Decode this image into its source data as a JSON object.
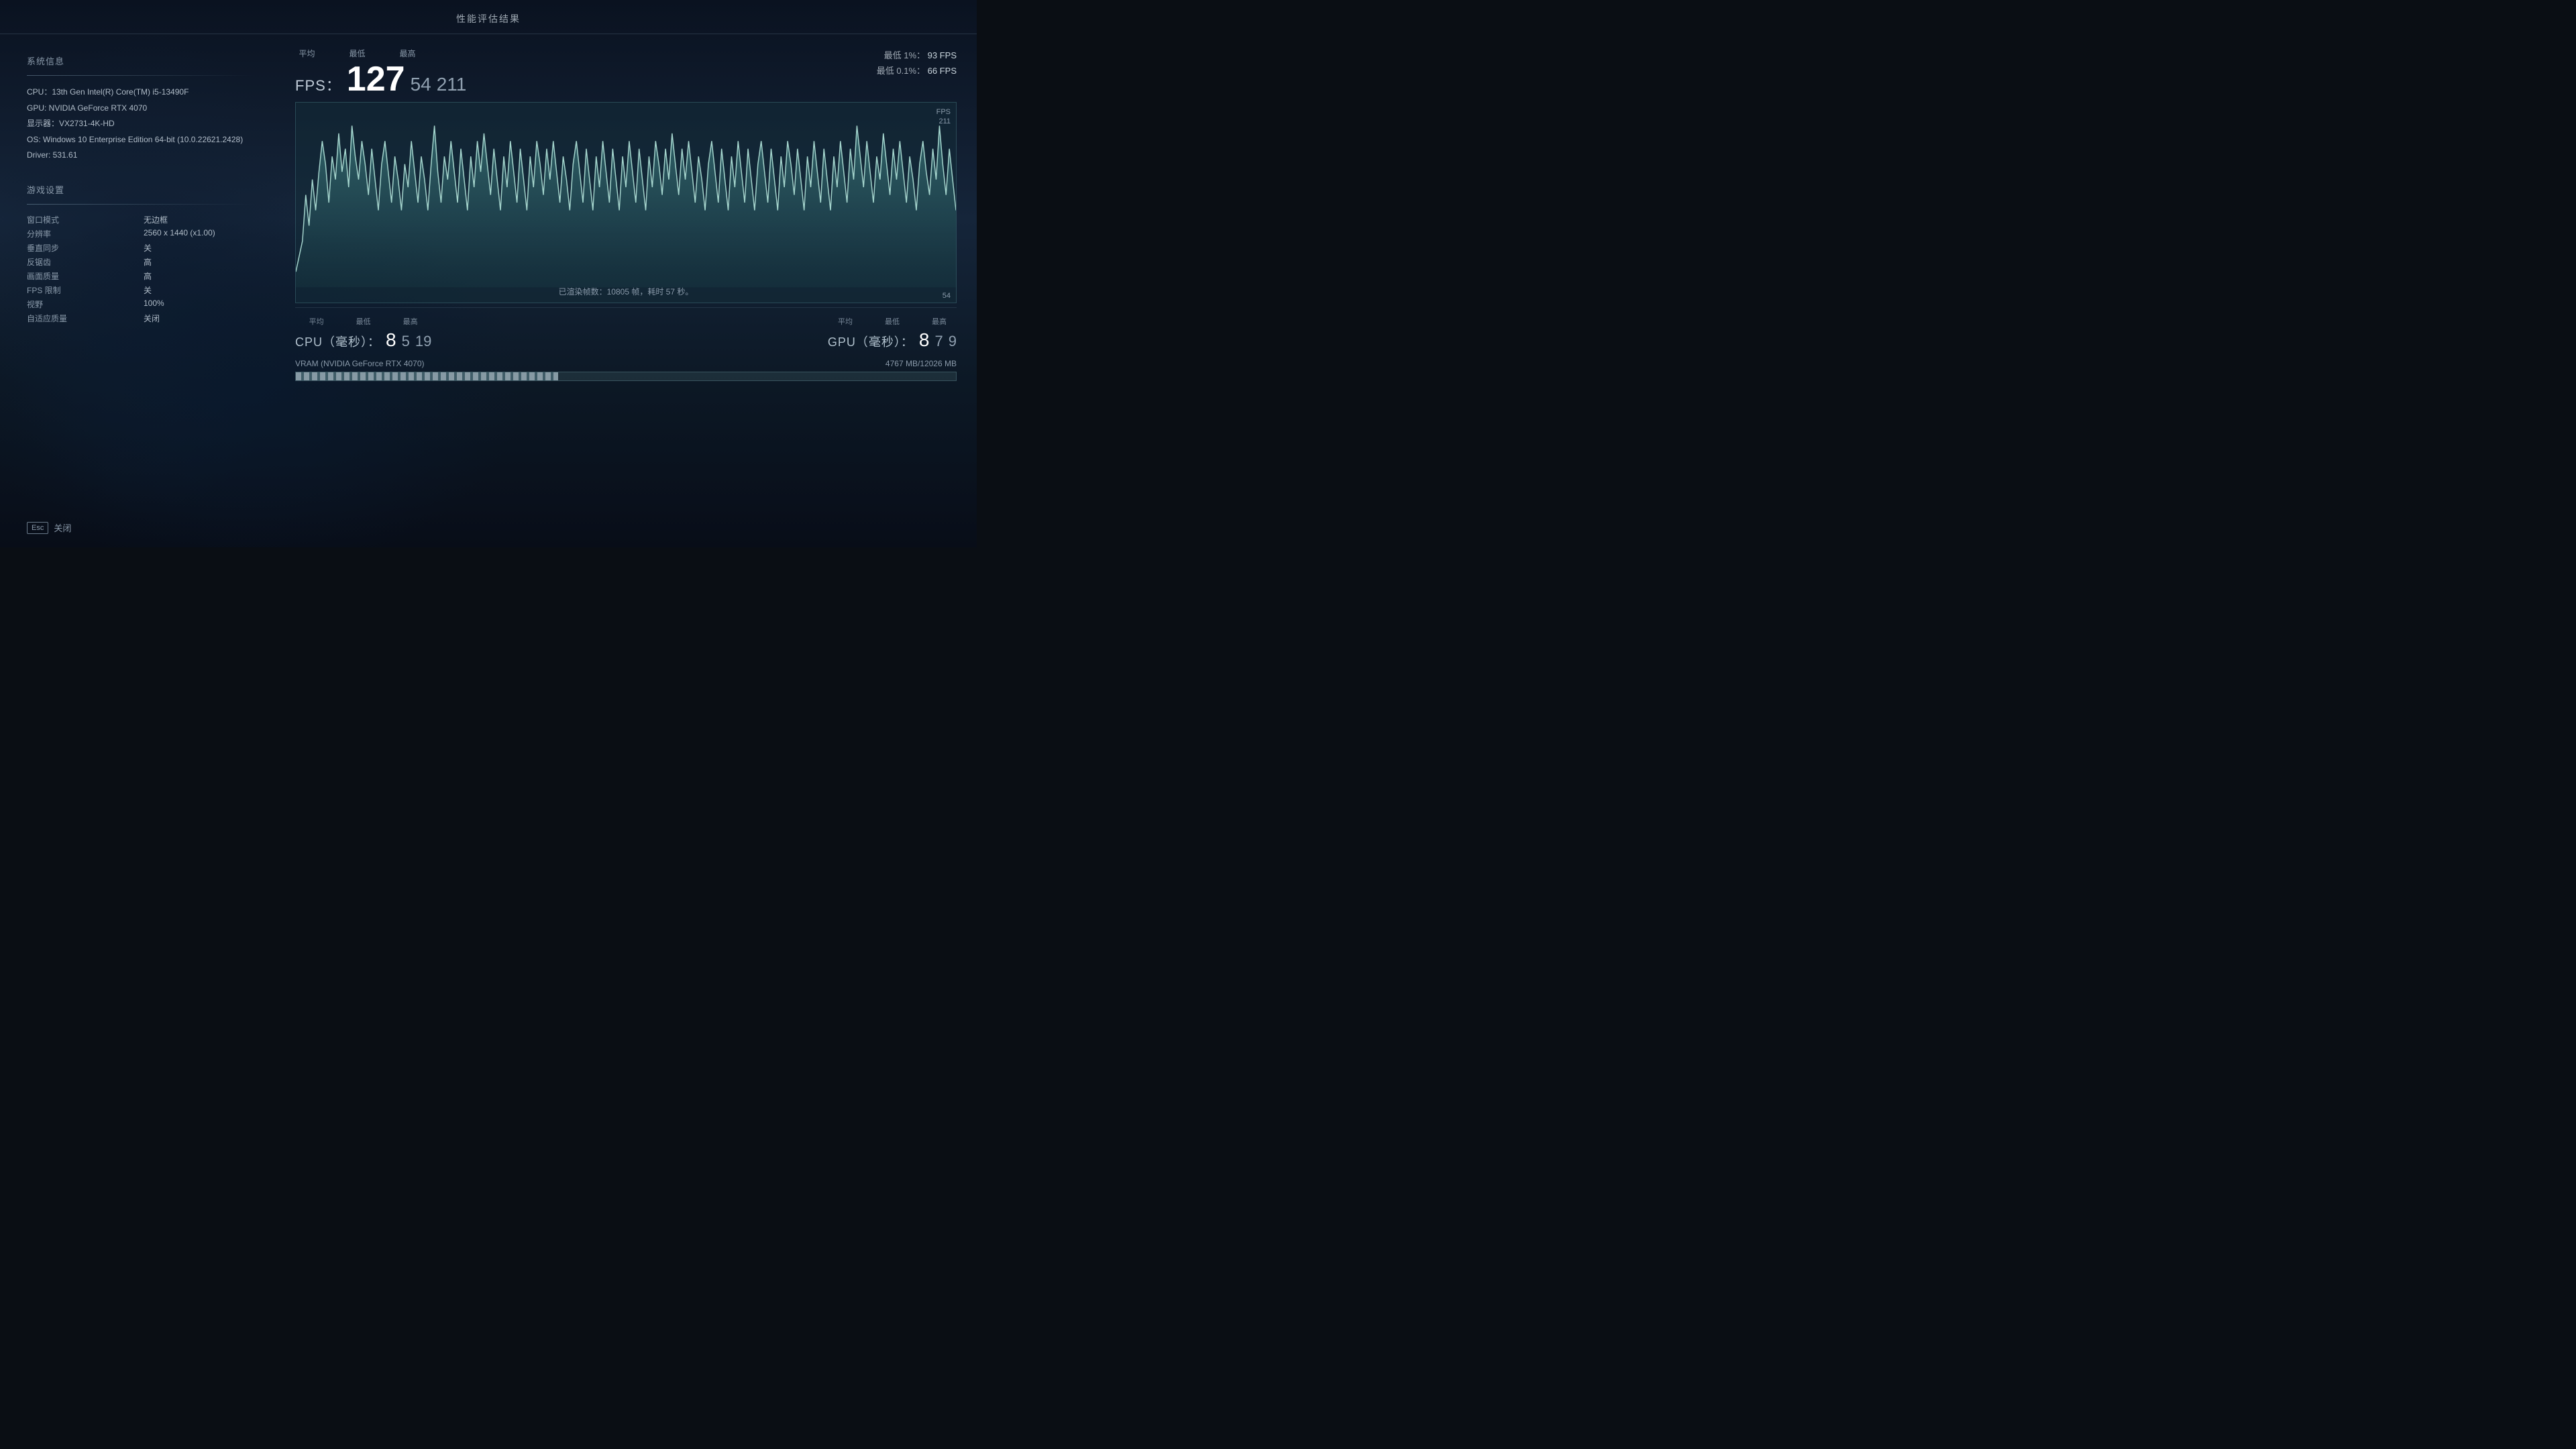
{
  "title": "性能评估结果",
  "system_info": {
    "section_title": "系统信息",
    "cpu": "CPU：13th Gen Intel(R) Core(TM) i5-13490F",
    "gpu": "GPU: NVIDIA GeForce RTX 4070",
    "display": "显示器：VX2731-4K-HD",
    "os": "OS: Windows 10 Enterprise Edition 64-bit (10.0.22621.2428)",
    "driver": "Driver: 531.61"
  },
  "game_settings": {
    "section_title": "游戏设置",
    "window_mode_label": "窗口模式",
    "window_mode_value": "无边框",
    "resolution_label": "分辨率",
    "resolution_value": "2560 x 1440 (x1.00)",
    "vsync_label": "垂直同步",
    "vsync_value": "关",
    "aa_label": "反锯齿",
    "aa_value": "高",
    "quality_label": "画面质量",
    "quality_value": "高",
    "fps_limit_label": "FPS 限制",
    "fps_limit_value": "关",
    "fov_label": "视野",
    "fov_value": "100%",
    "adaptive_label": "自适应质量",
    "adaptive_value": "关闭"
  },
  "fps_stats": {
    "label_avg": "平均",
    "label_min": "最低",
    "label_max": "最高",
    "fps_title": "FPS：",
    "fps_avg": "127",
    "fps_min": "54",
    "fps_max": "211",
    "low1_label": "最低 1%：",
    "low1_value": "93 FPS",
    "low01_label": "最低 0.1%：",
    "low01_value": "66 FPS",
    "chart_fps_label": "FPS",
    "chart_max_label": "211",
    "chart_min_label": "54",
    "rendered_info": "已渲染帧数：10805 帧，耗时 57 秒。"
  },
  "cpu_stats": {
    "label": "CPU（毫秒）：",
    "label_avg": "平均",
    "label_min": "最低",
    "label_max": "最高",
    "avg": "8",
    "min": "5",
    "max": "19"
  },
  "gpu_stats": {
    "label": "GPU（毫秒）：",
    "label_avg": "平均",
    "label_min": "最低",
    "label_max": "最高",
    "avg": "8",
    "min": "7",
    "max": "9"
  },
  "vram": {
    "label": "VRAM (NVIDIA GeForce RTX 4070)",
    "used": "4767 MB/12026 MB",
    "fill_percent": 39.7
  },
  "close": {
    "esc_label": "Esc",
    "close_label": "关闭"
  }
}
